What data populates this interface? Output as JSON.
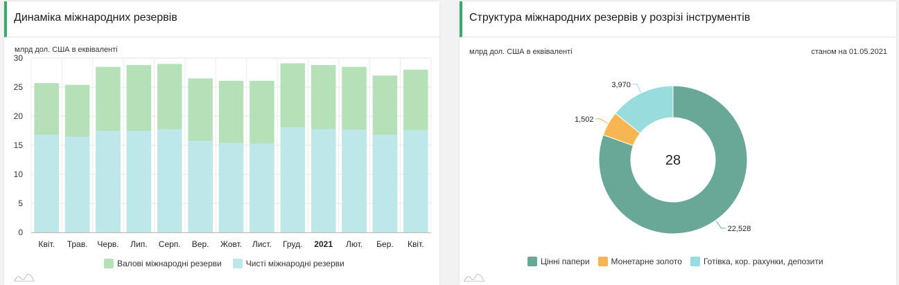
{
  "left_panel": {
    "title": "Динаміка міжнародних резервів",
    "unit": "млрд дол. США в еквіваленті"
  },
  "right_panel": {
    "title": "Структура міжнародних резервів у розрізі інструментів",
    "unit": "млрд дол. США в еквіваленті",
    "as_of": "станом на 01.05.2021",
    "center_total": "28"
  },
  "colors": {
    "gross": "#b5e0b8",
    "net": "#bde7e8",
    "securities": "#69a896",
    "gold": "#f8b652",
    "cash": "#99dcde",
    "accent": "#3aa86f"
  },
  "chart_data": [
    {
      "type": "bar",
      "categories": [
        "Квіт.",
        "Трав.",
        "Черв.",
        "Лип.",
        "Серп.",
        "Вер.",
        "Жовт.",
        "Лист.",
        "Груд.",
        "2021",
        "Лют.",
        "Бер.",
        "Квіт."
      ],
      "bold_categories": [
        "2021"
      ],
      "series": [
        {
          "name": "Валові міжнародні резерви",
          "values": [
            25.7,
            25.4,
            28.5,
            28.8,
            29.0,
            26.5,
            26.1,
            26.1,
            29.1,
            28.8,
            28.5,
            27.0,
            28.0
          ]
        },
        {
          "name": "Чисті міжнародні резерви",
          "values": [
            16.8,
            16.5,
            17.5,
            17.5,
            17.8,
            15.8,
            15.4,
            15.3,
            18.1,
            17.8,
            17.7,
            16.8,
            17.6
          ]
        }
      ],
      "overlapping": true,
      "ylim": [
        0,
        30
      ],
      "yticks": [
        0,
        5,
        10,
        15,
        20,
        25,
        30
      ],
      "grid": true,
      "legend": "bottom-center"
    },
    {
      "type": "pie",
      "donut": true,
      "slices": [
        {
          "name": "Цінні папери",
          "value": 22.528,
          "label": "22,528"
        },
        {
          "name": "Монетарне золото",
          "value": 1.502,
          "label": "1,502"
        },
        {
          "name": "Готівка, кор. рахунки, депозити",
          "value": 3.97,
          "label": "3,970"
        }
      ],
      "legend": "bottom-center"
    }
  ]
}
